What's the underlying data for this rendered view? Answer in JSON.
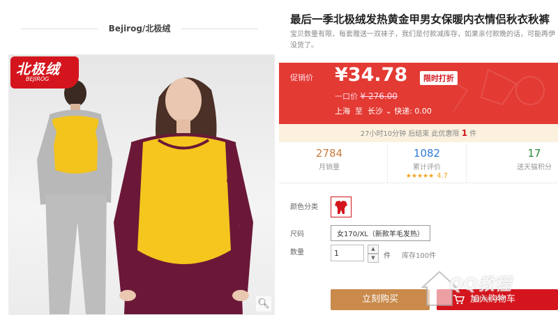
{
  "brand": {
    "name": "Bejirog/北极绒"
  },
  "logo": {
    "cn": "北极绒",
    "en": "BEJIROG"
  },
  "product": {
    "title": "最后一季北极绒发热黄金甲男女保暖内衣情侣秋衣秋裤",
    "subtitle": "宝贝数量有限，每套赠送一双袜子，我们是付款减库存，如果亲付款晚的话，可能再伊没货了。"
  },
  "price": {
    "label": "促销价",
    "current": "¥34.78",
    "tag": "限时打折",
    "original_label": "一口价",
    "original": "¥ 276.00",
    "ship_from": "上海",
    "ship_to_word": "至",
    "ship_to": "长沙",
    "shipping": "快递: 0.00"
  },
  "countdown": {
    "text": "27小时10分钟 后结束   此优惠限",
    "limit": "1",
    "unit": "件"
  },
  "stats": [
    {
      "value": "2784",
      "label": "月销量"
    },
    {
      "value": "1082",
      "label": "累计评价",
      "stars": "★★★★★",
      "score": "4.7"
    },
    {
      "value": "17",
      "label": "送天猫积分"
    }
  ],
  "options": {
    "color_label": "颜色分类",
    "size_label": "尺码",
    "size_value": "女170/XL（新款羊毛发热）",
    "qty_label": "数量",
    "qty_value": "1",
    "qty_unit": "件",
    "stock": "库存100件"
  },
  "buttons": {
    "buy": "立刻购买",
    "cart": "加入购物车"
  },
  "watermark": {
    "text": "QQ教程",
    "sub": "qqhjia.com"
  },
  "colors": {
    "accent": "#d4151d",
    "price_bg": "#e33a33",
    "buy": "#c98a4b"
  }
}
